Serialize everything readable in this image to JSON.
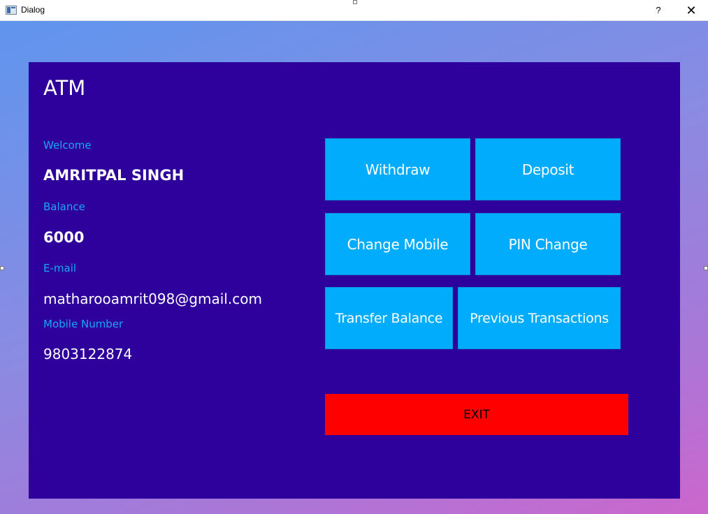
{
  "window": {
    "title": "Dialog",
    "help": "?",
    "close": "✕"
  },
  "atm": {
    "title": "ATM",
    "welcome_label": "Welcome",
    "name": "AMRITPAL SINGH",
    "balance_label": "Balance",
    "balance": "6000",
    "email_label": "E-mail",
    "email": "matharooamrit098@gmail.com",
    "mobile_label": "Mobile Number",
    "mobile": "9803122874"
  },
  "buttons": {
    "withdraw": "Withdraw",
    "deposit": "Deposit",
    "change_mobile": "Change Mobile",
    "pin_change": "PIN Change",
    "transfer_balance": "Transfer Balance",
    "previous_transactions": "Previous Transactions",
    "exit": "EXIT"
  },
  "colors": {
    "panel": "#2e009c",
    "label": "#1aa7f5",
    "button": "#00acfb",
    "exit": "#ff0000"
  }
}
